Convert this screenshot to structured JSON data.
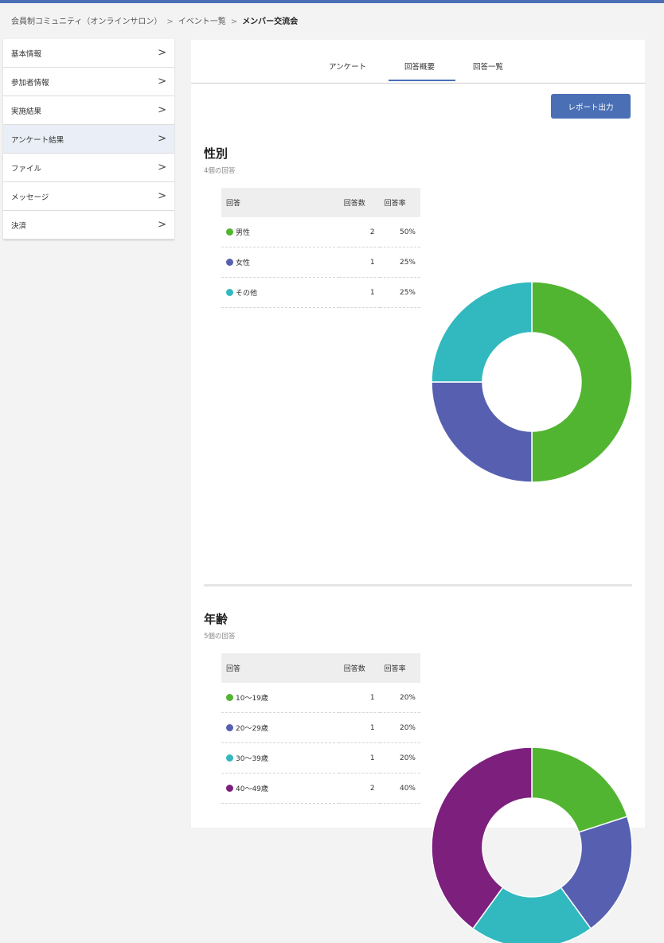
{
  "breadcrumb": {
    "item1": "会員制コミュニティ（オンラインサロン）",
    "sep": ">",
    "item2": "イベント一覧",
    "current": "メンバー交流会"
  },
  "sidebar": {
    "items": [
      {
        "label": "基本情報",
        "chevron": ">"
      },
      {
        "label": "参加者情報",
        "chevron": ">"
      },
      {
        "label": "実施結果",
        "chevron": ">"
      },
      {
        "label": "アンケート結果",
        "chevron": ">"
      },
      {
        "label": "ファイル",
        "chevron": ">"
      },
      {
        "label": "メッセージ",
        "chevron": ">"
      },
      {
        "label": "決済",
        "chevron": ">"
      }
    ]
  },
  "tabs": {
    "survey": "アンケート",
    "summary": "回答概要",
    "list": "回答一覧"
  },
  "report_button": "レポート出力",
  "table_headers": {
    "answer": "回答",
    "count": "回答数",
    "rate": "回答率"
  },
  "colors": {
    "accent": "#4a6fb5",
    "green": "#52b531",
    "blue": "#5760b0",
    "teal": "#31b9bf",
    "purple": "#7c1f7d"
  },
  "gender": {
    "title": "性別",
    "subtitle": "4個の回答",
    "rows": [
      {
        "label": "男性",
        "count": "2",
        "rate": "50%",
        "color": "#52b531"
      },
      {
        "label": "女性",
        "count": "1",
        "rate": "25%",
        "color": "#5760b0"
      },
      {
        "label": "その他",
        "count": "1",
        "rate": "25%",
        "color": "#31b9bf"
      }
    ]
  },
  "age": {
    "title": "年齢",
    "subtitle": "5個の回答",
    "rows": [
      {
        "label": "10～19歳",
        "count": "1",
        "rate": "20%",
        "color": "#52b531"
      },
      {
        "label": "20～29歳",
        "count": "1",
        "rate": "20%",
        "color": "#5760b0"
      },
      {
        "label": "30～39歳",
        "count": "1",
        "rate": "20%",
        "color": "#31b9bf"
      },
      {
        "label": "40～49歳",
        "count": "2",
        "rate": "40%",
        "color": "#7c1f7d"
      }
    ]
  },
  "chart_data": [
    {
      "type": "pie",
      "categories": [
        "男性",
        "女性",
        "その他"
      ],
      "values": [
        2,
        1,
        1
      ],
      "colors": [
        "#52b531",
        "#5760b0",
        "#31b9bf"
      ]
    },
    {
      "type": "pie",
      "categories": [
        "10～19歳",
        "20～29歳",
        "30～39歳",
        "40～49歳"
      ],
      "values": [
        1,
        1,
        1,
        2
      ],
      "colors": [
        "#52b531",
        "#5760b0",
        "#31b9bf",
        "#7c1f7d"
      ]
    }
  ]
}
